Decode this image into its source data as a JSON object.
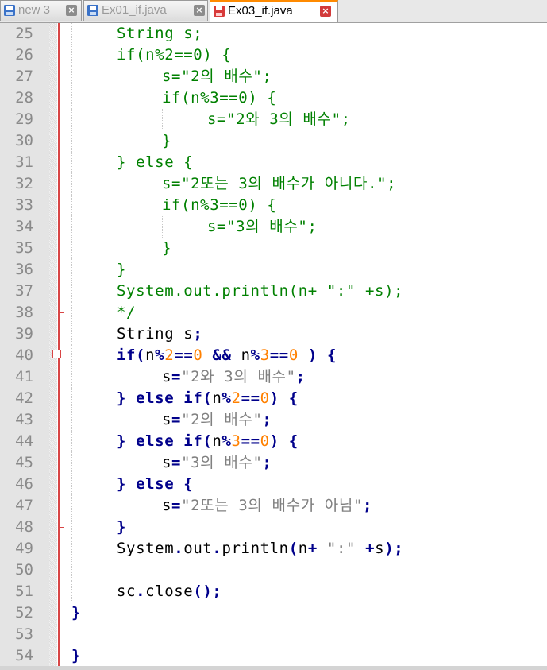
{
  "tabs": [
    {
      "label": "new 3",
      "icon": "saved-file-icon",
      "active": false
    },
    {
      "label": "Ex01_if.java",
      "icon": "saved-file-icon",
      "active": false
    },
    {
      "label": "Ex03_if.java",
      "icon": "modified-file-icon",
      "active": true
    }
  ],
  "colors": {
    "comment": "#008000",
    "keyword": "#00008b",
    "number": "#ff8000",
    "string": "#808080",
    "gutter": "#e4e4e4",
    "fold_margin_line": "#d84545",
    "active_tab_accent": "#ff8a00"
  },
  "editor": {
    "lines": [
      {
        "n": "25",
        "t": "String s;",
        "guides": 1
      },
      {
        "n": "26",
        "t": "if(n%2==0) {",
        "guides": 1
      },
      {
        "n": "27",
        "t": "s=\"2의 배수\";",
        "guides": 2
      },
      {
        "n": "28",
        "t": "if(n%3==0) {",
        "guides": 2
      },
      {
        "n": "29",
        "t": "s=\"2와 3의 배수\";",
        "guides": 3
      },
      {
        "n": "30",
        "t": "}",
        "guides": 2
      },
      {
        "n": "31",
        "t": "} else {",
        "guides": 1
      },
      {
        "n": "32",
        "t": "s=\"2또는 3의 배수가 아니다.\";",
        "guides": 2
      },
      {
        "n": "33",
        "t": "if(n%3==0) {",
        "guides": 2
      },
      {
        "n": "34",
        "t": "s=\"3의 배수\";",
        "guides": 3
      },
      {
        "n": "35",
        "t": "}",
        "guides": 2
      },
      {
        "n": "36",
        "t": "}",
        "guides": 1
      },
      {
        "n": "37",
        "t": "System.out.println(n+ \":\" +s);",
        "guides": 1
      },
      {
        "n": "38",
        "t": "*/",
        "guides": 1
      },
      {
        "n": "39",
        "t": "String s;",
        "guides": 1
      },
      {
        "n": "40",
        "t": "if(n%2==0 && n%3==0 ) {",
        "guides": 1
      },
      {
        "n": "41",
        "t": "s=\"2와 3의 배수\";",
        "guides": 2
      },
      {
        "n": "42",
        "t": "} else if(n%2==0) {",
        "guides": 1
      },
      {
        "n": "43",
        "t": "s=\"2의 배수\";",
        "guides": 2
      },
      {
        "n": "44",
        "t": "} else if(n%3==0) {",
        "guides": 1
      },
      {
        "n": "45",
        "t": "s=\"3의 배수\";",
        "guides": 2
      },
      {
        "n": "46",
        "t": "} else {",
        "guides": 1
      },
      {
        "n": "47",
        "t": "s=\"2또는 3의 배수가 아님\";",
        "guides": 2
      },
      {
        "n": "48",
        "t": "}",
        "guides": 1
      },
      {
        "n": "49",
        "t": "System.out.println(n+ \":\" +s);",
        "guides": 1
      },
      {
        "n": "50",
        "t": "",
        "guides": 1
      },
      {
        "n": "51",
        "t": "sc.close();",
        "guides": 1
      },
      {
        "n": "52",
        "t": "}",
        "guides": 0
      },
      {
        "n": "53",
        "t": "",
        "guides": 0
      },
      {
        "n": "54",
        "t": "}",
        "guides": 0
      }
    ]
  }
}
